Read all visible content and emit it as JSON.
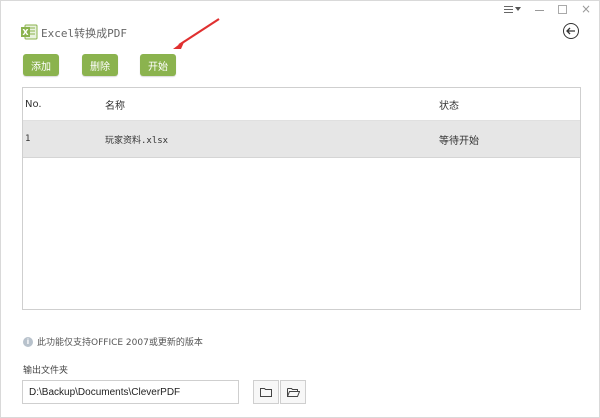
{
  "app": {
    "title": "Excel转换成PDF",
    "icons": {
      "logo": "excel-logo-icon",
      "back": "back-arrow-icon"
    }
  },
  "window_controls": {
    "menu": "hamburger-menu-icon",
    "minimize": "minimize-icon",
    "maximize": "maximize-icon",
    "close": "×"
  },
  "toolbar": {
    "add_label": "添加",
    "delete_label": "删除",
    "start_label": "开始",
    "button_color": "#8bb34e"
  },
  "annotation": {
    "color": "#e03030",
    "type": "arrow"
  },
  "table": {
    "columns": [
      "No.",
      "名称",
      "状态"
    ],
    "rows": [
      {
        "no": "1",
        "name": "玩家资料.xlsx",
        "status": "等待开始"
      }
    ]
  },
  "info": {
    "text": "此功能仅支持OFFICE 2007或更新的版本"
  },
  "output": {
    "label": "输出文件夹",
    "path": "D:\\Backup\\Documents\\CleverPDF",
    "browse_icon": "folder-icon",
    "open_icon": "open-folder-icon"
  }
}
